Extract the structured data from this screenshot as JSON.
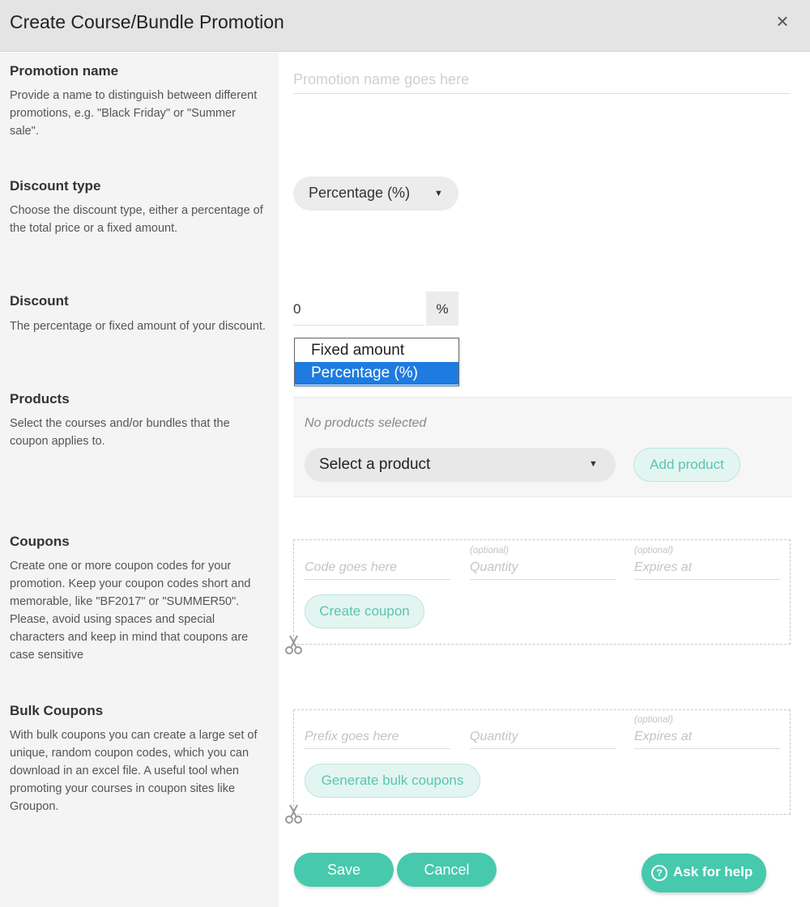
{
  "dialog": {
    "title": "Create Course/Bundle Promotion",
    "close_glyph": "×"
  },
  "promotion_name": {
    "title": "Promotion name",
    "description": "Provide a name to distinguish between different promotions, e.g. \"Black Friday\" or \"Summer sale\".",
    "placeholder": "Promotion name goes here",
    "value": ""
  },
  "discount_type": {
    "title": "Discount type",
    "description": "Choose the discount type, either a percentage of the total price or a fixed amount.",
    "selected": "Percentage (%)",
    "caret": "▼",
    "options": [
      "Fixed amount",
      "Percentage (%)"
    ]
  },
  "discount": {
    "title": "Discount",
    "description": "The percentage or fixed amount of your discount.",
    "value": "0",
    "unit": "%"
  },
  "products": {
    "title": "Products",
    "description": "Select the courses and/or bundles that the coupon applies to.",
    "empty_text": "No products selected",
    "select_label": "Select a product",
    "caret": "▼",
    "add_label": "Add product"
  },
  "coupons": {
    "title": "Coupons",
    "description": "Create one or more coupon codes for your promotion. Keep your coupon codes short and memorable, like \"BF2017\" or \"SUMMER50\". Please, avoid using spaces and special characters and keep in mind that coupons are case sensitive",
    "code_placeholder": "Code goes here",
    "quantity_optional": "(optional)",
    "quantity_placeholder": "Quantity",
    "expires_optional": "(optional)",
    "expires_placeholder": "Expires at",
    "create_label": "Create coupon"
  },
  "bulk_coupons": {
    "title": "Bulk Coupons",
    "description": "With bulk coupons you can create a large set of unique, random coupon codes, which you can download in an excel file. A useful tool when promoting your courses in coupon sites like Groupon.",
    "prefix_placeholder": "Prefix goes here",
    "quantity_placeholder": "Quantity",
    "expires_optional": "(optional)",
    "expires_placeholder": "Expires at",
    "generate_label": "Generate bulk coupons"
  },
  "actions": {
    "save_label": "Save",
    "cancel_label": "Cancel"
  },
  "help": {
    "icon_glyph": "?",
    "label": "Ask for help"
  },
  "colors": {
    "accent": "#46c9ad",
    "accent_light": "#e3f5f1",
    "selected_option": "#1e7be0",
    "header_bg": "#e4e4e4",
    "left_panel_bg": "#f4f4f4"
  },
  "icons": {
    "close": "close-icon",
    "caret": "caret-down-icon",
    "scissors": "scissors-icon",
    "help": "question-circle-icon"
  }
}
